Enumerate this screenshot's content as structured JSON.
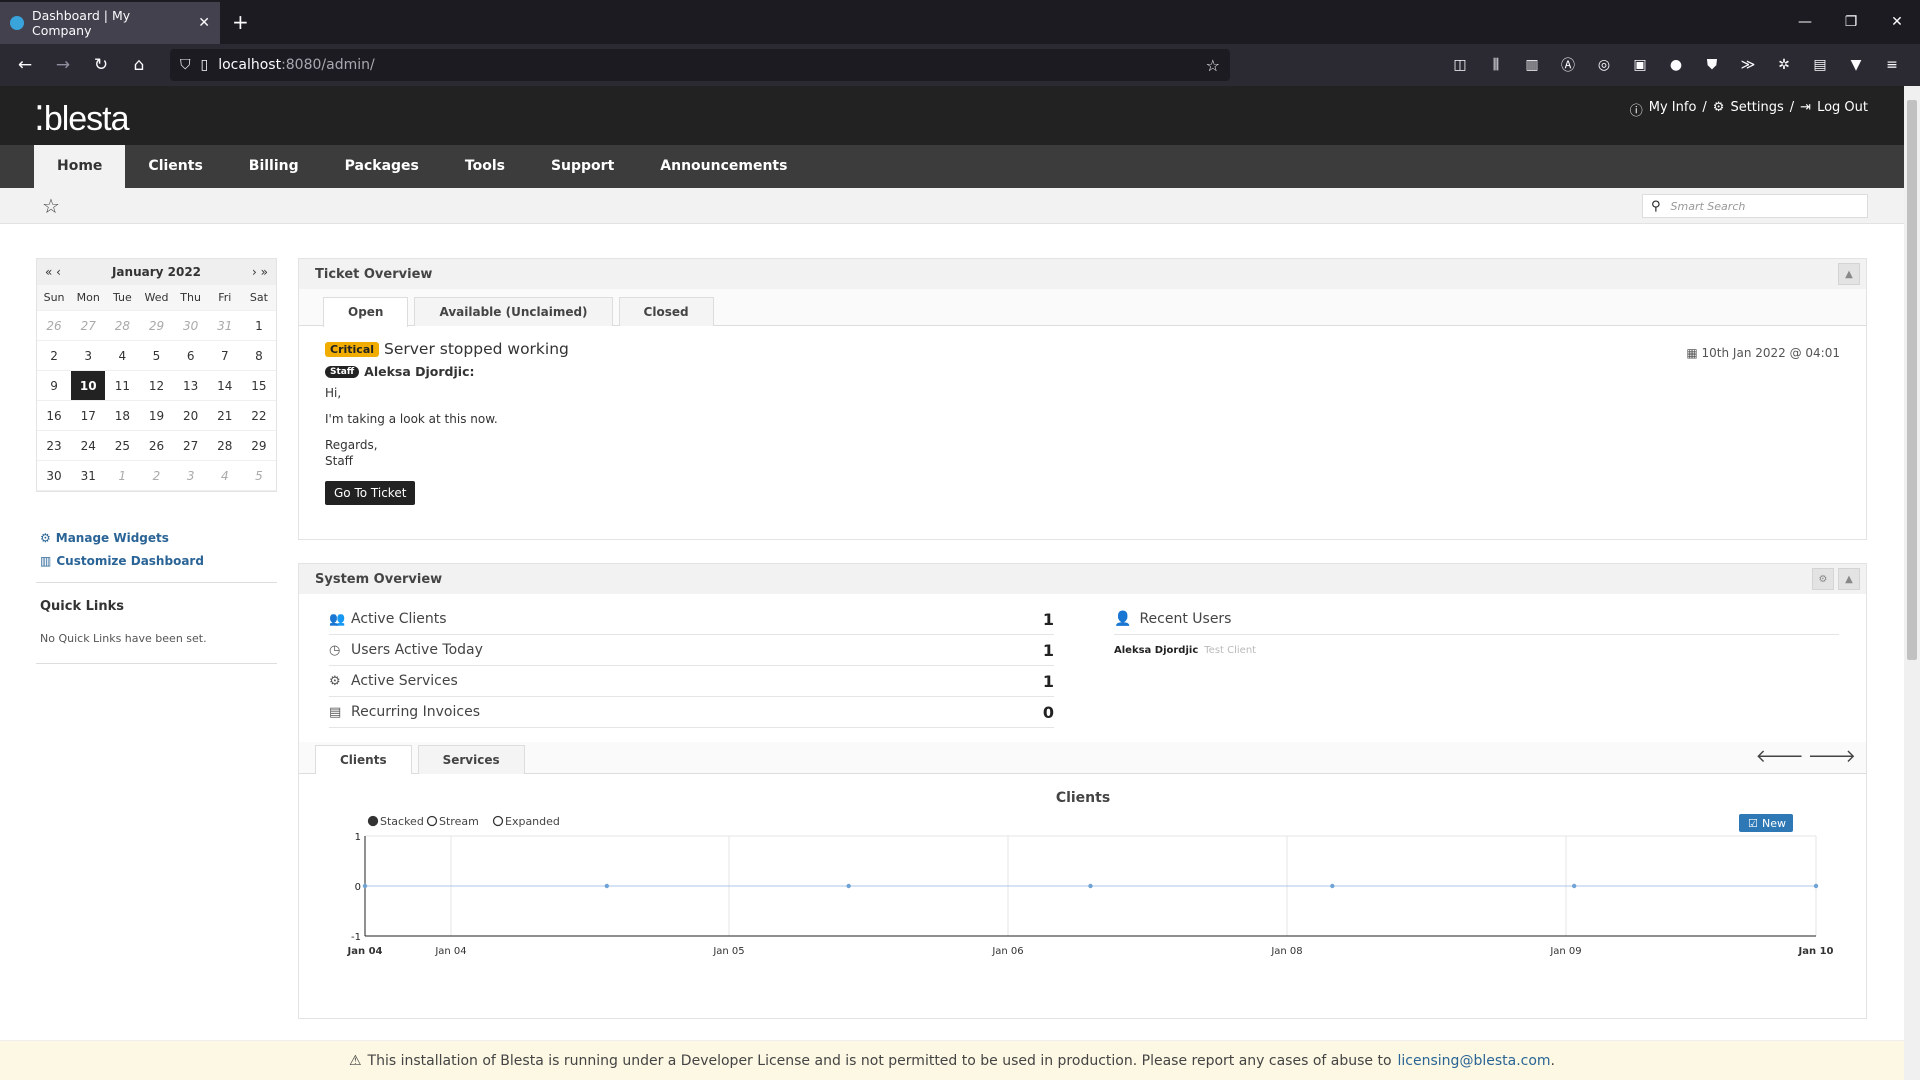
{
  "browser": {
    "tab_title": "Dashboard | My Company",
    "url_host": "localhost",
    "url_path": ":8080/admin/"
  },
  "header": {
    "logo": "blesta",
    "my_info": "My Info",
    "settings": "Settings",
    "logout": "Log Out",
    "sep": "/"
  },
  "nav": [
    "Home",
    "Clients",
    "Billing",
    "Packages",
    "Tools",
    "Support",
    "Announcements"
  ],
  "search": {
    "placeholder": "Smart Search"
  },
  "calendar": {
    "month": "January 2022",
    "prev": "« ‹",
    "next": "› »",
    "dow": [
      "Sun",
      "Mon",
      "Tue",
      "Wed",
      "Thu",
      "Fri",
      "Sat"
    ],
    "weeks": [
      [
        "26",
        "27",
        "28",
        "29",
        "30",
        "31",
        "1"
      ],
      [
        "2",
        "3",
        "4",
        "5",
        "6",
        "7",
        "8"
      ],
      [
        "9",
        "10",
        "11",
        "12",
        "13",
        "14",
        "15"
      ],
      [
        "16",
        "17",
        "18",
        "19",
        "20",
        "21",
        "22"
      ],
      [
        "23",
        "24",
        "25",
        "26",
        "27",
        "28",
        "29"
      ],
      [
        "30",
        "31",
        "1",
        "2",
        "3",
        "4",
        "5"
      ]
    ]
  },
  "left": {
    "manage_widgets": "Manage Widgets",
    "customize_dashboard": "Customize Dashboard",
    "quick_links_title": "Quick Links",
    "quick_links_empty": "No Quick Links have been set."
  },
  "ticket_overview": {
    "title": "Ticket Overview",
    "tabs": [
      "Open",
      "Available (Unclaimed)",
      "Closed"
    ],
    "priority": "Critical",
    "subject": "Server stopped working",
    "date": "10th Jan 2022 @ 04:01",
    "staff_badge": "Staff",
    "author": "Aleksa Djordjic:",
    "lines": [
      "Hi,",
      "I'm taking a look at this now.",
      "Regards,",
      "Staff"
    ],
    "button": "Go To Ticket"
  },
  "system_overview": {
    "title": "System Overview",
    "stats": [
      {
        "label": "Active Clients",
        "value": "1",
        "icon": "users-icon"
      },
      {
        "label": "Users Active Today",
        "value": "1",
        "icon": "clock-icon"
      },
      {
        "label": "Active Services",
        "value": "1",
        "icon": "cogs-icon"
      },
      {
        "label": "Recurring Invoices",
        "value": "0",
        "icon": "file-icon"
      }
    ],
    "recent_users_title": "Recent Users",
    "recent_user_name": "Aleksa Djordjic",
    "recent_user_client": "Test Client",
    "chart_tabs": [
      "Clients",
      "Services"
    ]
  },
  "chart_data": {
    "type": "line",
    "title": "Clients",
    "modes": [
      "Stacked",
      "Stream",
      "Expanded"
    ],
    "selected_mode": "Stacked",
    "legend": "New",
    "legend_position": "top-right",
    "x_ticks": [
      "Jan 04",
      "Jan 04",
      "Jan 05",
      "Jan 06",
      "Jan 08",
      "Jan 09",
      "Jan 10"
    ],
    "y_ticks": [
      "1",
      "0",
      "-1"
    ],
    "ylim": [
      -1,
      1
    ],
    "series": [
      {
        "name": "New",
        "values": [
          0,
          0,
          0,
          0,
          0,
          0,
          0
        ]
      }
    ],
    "grid": true
  },
  "notice": {
    "text": "This installation of Blesta is running under a Developer License and is not permitted to be used in production. Please report any cases of abuse to",
    "email": "licensing@blesta.com",
    "end": "."
  }
}
